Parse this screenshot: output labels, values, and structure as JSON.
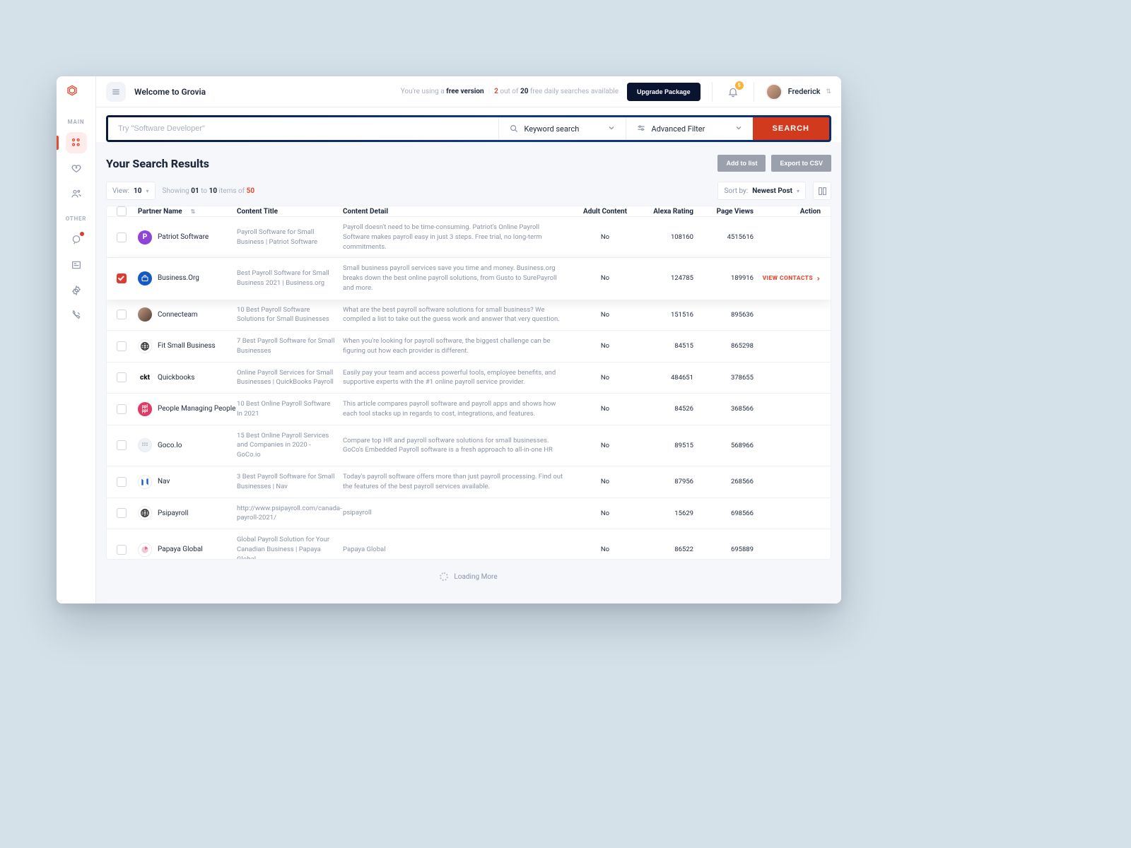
{
  "header": {
    "welcome": "Welcome to Grovia",
    "free_prefix": "You're using a ",
    "free_bold": "free version",
    "free_count": "2",
    "free_suffix_a": " out of ",
    "free_total": "20",
    "free_suffix_b": " free daily searches available",
    "upgrade_label": "Upgrade Package",
    "notification_count": "5",
    "user_name": "Frederick"
  },
  "sidebar": {
    "section_main": "MAIN",
    "section_other": "OTHER"
  },
  "searchbar": {
    "placeholder": "Try \"Software Developer\"",
    "keyword_label": "Keyword search",
    "filter_label": "Advanced Filter",
    "button_label": "SEARCH"
  },
  "results": {
    "title": "Your Search Results",
    "add_to_list": "Add to list",
    "export_csv": "Export to CSV",
    "view_label": "View:",
    "view_value": "10",
    "showing_prefix": "Showing ",
    "showing_from": "01",
    "showing_to_word": " to ",
    "showing_to": "10",
    "showing_items_word": " items of ",
    "showing_total": "50",
    "sort_label": "Sort by:",
    "sort_value": "Newest Post",
    "loading": "Loading More",
    "view_contacts": "VIEW CONTACTS"
  },
  "columns": {
    "partner": "Partner Name",
    "title": "Content Title",
    "detail": "Content Detail",
    "adult": "Adult Content",
    "alexa": "Alexa Rating",
    "views": "Page Views",
    "action": "Action"
  },
  "rows": [
    {
      "selected": false,
      "logo_bg": "#8e44d6",
      "logo_text": "P",
      "logo_style": "circle",
      "partner": "Patriot Software",
      "title": "Payroll Software for Small Business | Patriot Software",
      "detail": "Payroll doesn't need to be time-consuming. Patriot's Online Payroll Software makes payroll easy in just 3 steps. Free trial, no long-term commitments.",
      "adult": "No",
      "alexa": "108160",
      "views": "4515616"
    },
    {
      "selected": true,
      "logo_bg": "#1559c4",
      "logo_text": "",
      "logo_style": "bag",
      "partner": "Business.Org",
      "title": "Best Payroll Software for Small Business 2021 | Business.org",
      "detail": "Small business payroll services save you time and money. Business.org breaks down the best online payroll solutions, from Gusto to SurePayroll and more.",
      "adult": "No",
      "alexa": "124785",
      "views": "189916"
    },
    {
      "selected": false,
      "logo_bg": "#2b2b2b",
      "logo_text": "",
      "logo_style": "photo",
      "partner": "Connecteam",
      "title": "10 Best Payroll Software Solutions for Small Businesses",
      "detail": "What are the best payroll software solutions for small business? We compiled a list to take out the guess work and answer that very question.",
      "adult": "No",
      "alexa": "151516",
      "views": "895636"
    },
    {
      "selected": false,
      "logo_bg": "#ffffff",
      "logo_text": "",
      "logo_style": "globe",
      "partner": "Fit Small Business",
      "title": "7 Best Payroll Software for Small Businesses",
      "detail": "When you're looking for payroll software, the biggest challenge can be figuring out how each provider is different.",
      "adult": "No",
      "alexa": "84515",
      "views": "865298"
    },
    {
      "selected": false,
      "logo_bg": "#ffffff",
      "logo_text": "ckt",
      "logo_style": "text-dark",
      "partner": "Quickbooks",
      "title": "Online Payroll Services for Small Businesses | QuickBooks Payroll",
      "detail": "Easily pay your team and access powerful tools, employee benefits, and supportive experts with the #1 online payroll service provider.",
      "adult": "No",
      "alexa": "484651",
      "views": "378655"
    },
    {
      "selected": false,
      "logo_bg": "#e23a65",
      "logo_text": "ppl",
      "logo_style": "circle-small",
      "partner": "People Managing People",
      "title": "10 Best Online Payroll Software In 2021",
      "detail": "This article compares payroll software and payroll apps and shows how each tool stacks up in regards to cost, integrations, and features.",
      "adult": "No",
      "alexa": "84526",
      "views": "368566"
    },
    {
      "selected": false,
      "logo_bg": "#eef1f6",
      "logo_text": "",
      "logo_style": "dots",
      "partner": "Goco.Io",
      "title": "15 Best Online Payroll Services and Companies in 2020 - GoCo.io",
      "detail": "Compare top HR and payroll software solutions for small businesses. GoCo's Embedded Payroll software is a fresh approach to all-in-one HR",
      "adult": "No",
      "alexa": "89515",
      "views": "568966"
    },
    {
      "selected": false,
      "logo_bg": "#ffffff",
      "logo_text": "N",
      "logo_style": "nav",
      "partner": "Nav",
      "title": "3 Best Payroll Software for Small Businesses | Nav",
      "detail": "Today's payroll software offers more than just payroll processing. Find out the features of the best payroll services available.",
      "adult": "No",
      "alexa": "87956",
      "views": "268566"
    },
    {
      "selected": false,
      "logo_bg": "#ffffff",
      "logo_text": "",
      "logo_style": "globe",
      "partner": "Psipayroll",
      "title": "http://www.psipayroll.com/canada-payroll-2021/",
      "detail": "psipayroll",
      "adult": "No",
      "alexa": "15629",
      "views": "698566"
    },
    {
      "selected": false,
      "logo_bg": "#ffffff",
      "logo_text": "",
      "logo_style": "pie",
      "partner": "Papaya Global",
      "title": "Global Payroll Solution for Your Canadian Business | Papaya Global",
      "detail": "Papaya Global",
      "adult": "No",
      "alexa": "86522",
      "views": "695889"
    }
  ]
}
